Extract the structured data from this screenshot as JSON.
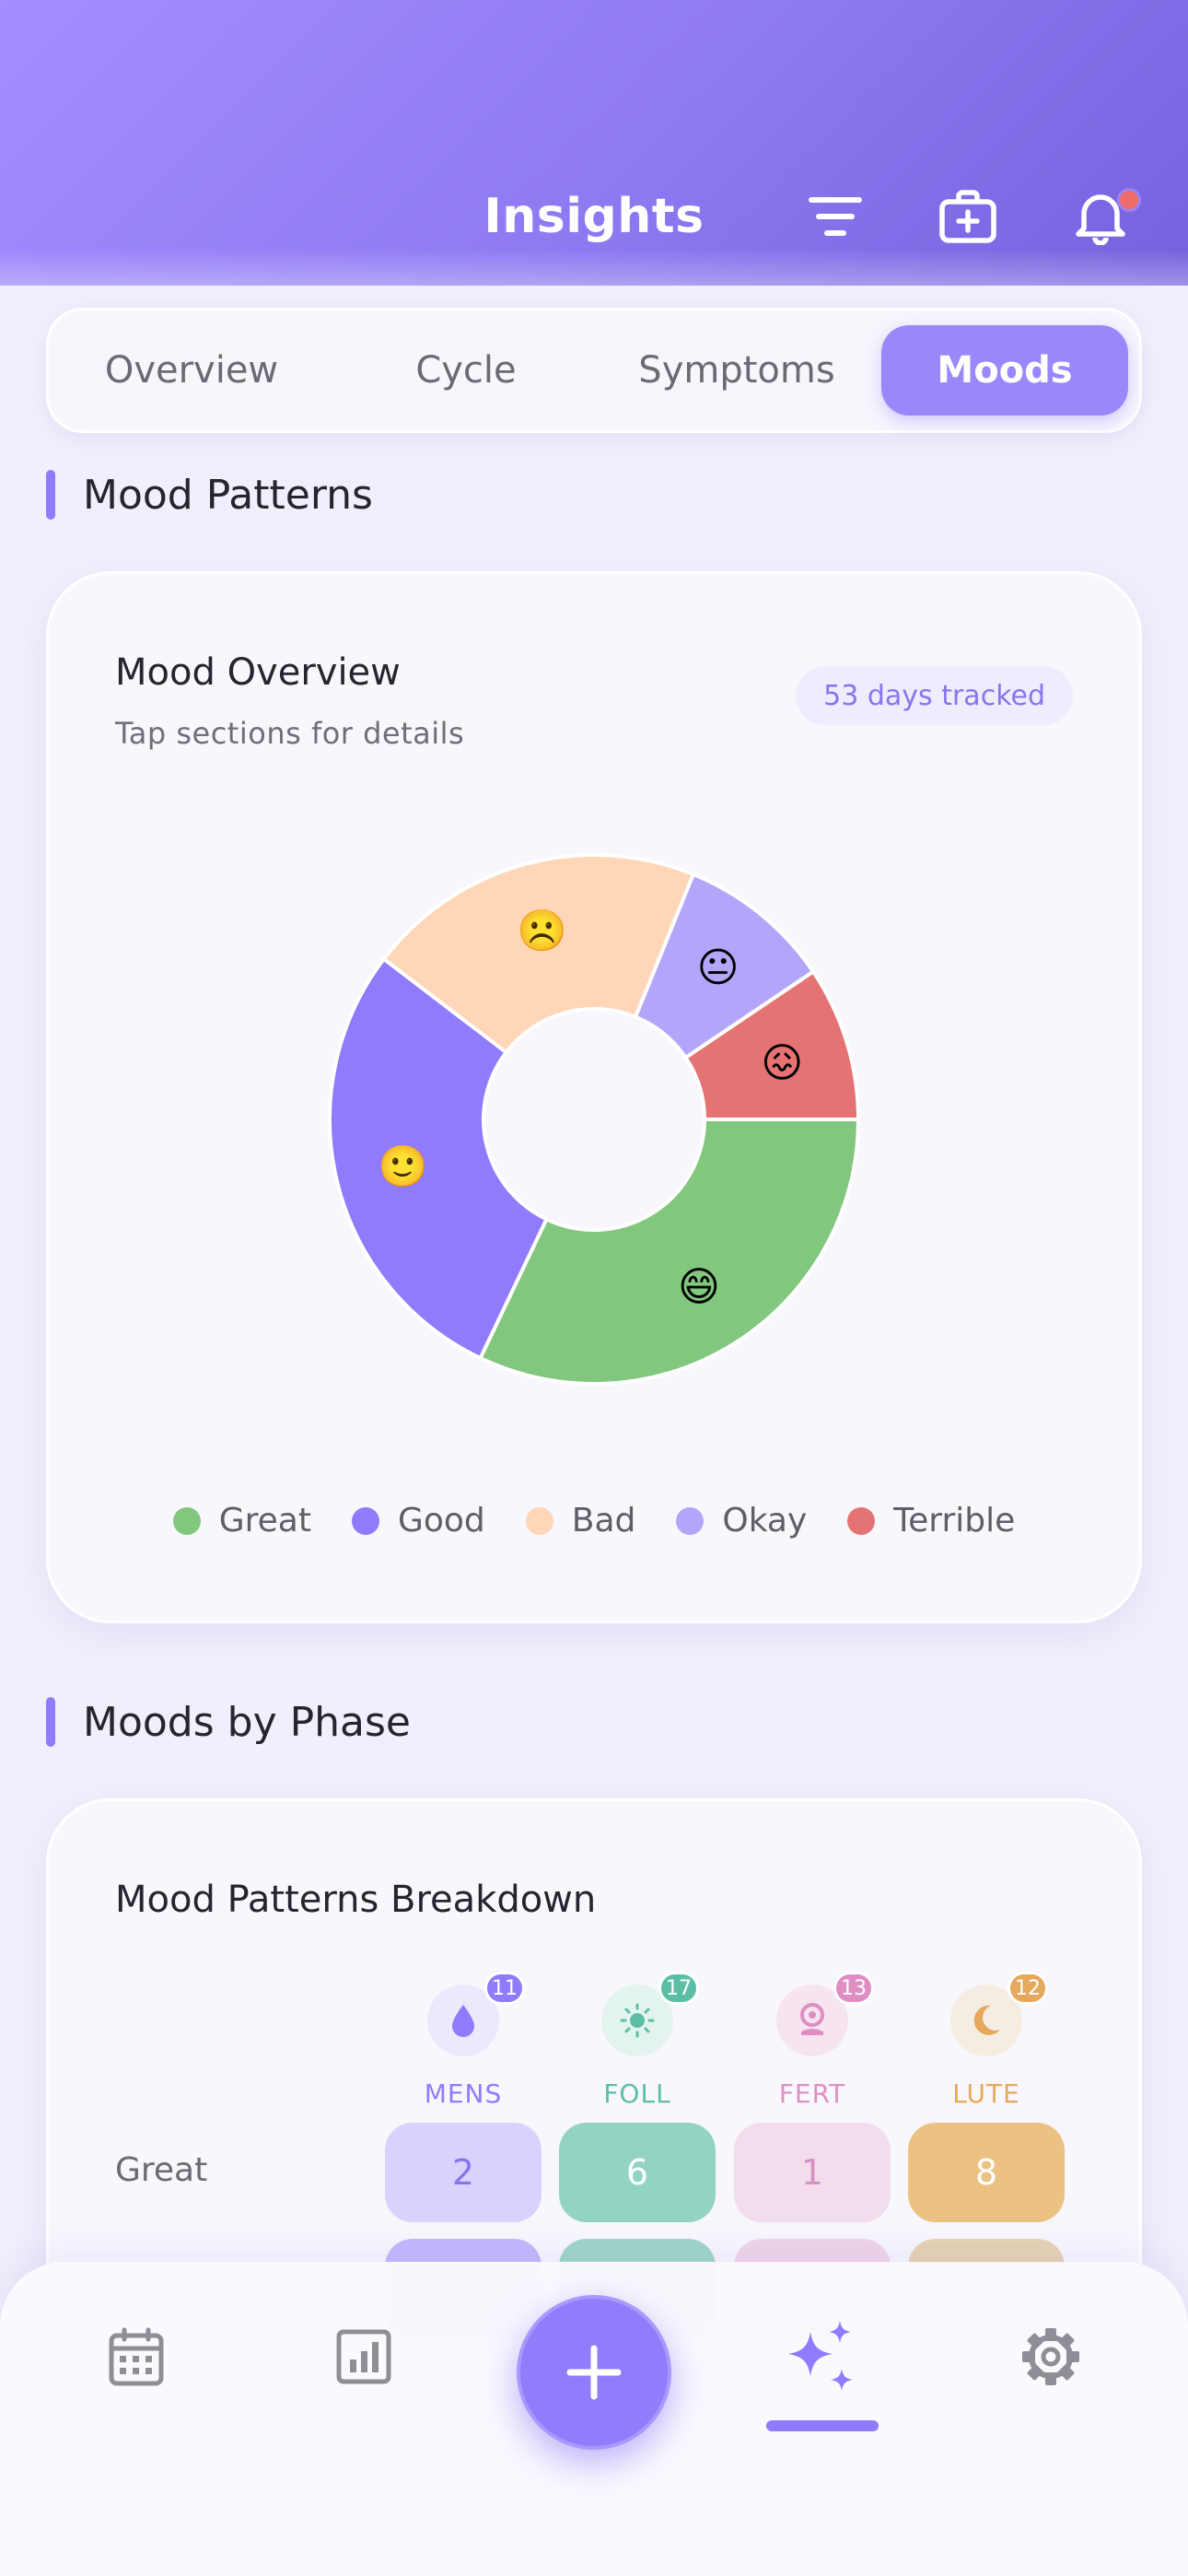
{
  "header": {
    "title": "Insights",
    "icons": [
      "filter-icon",
      "first-aid-kit-icon",
      "bell-icon"
    ],
    "notification_dot_color": "#ef6b6b"
  },
  "tabs": [
    {
      "label": "Overview",
      "active": false
    },
    {
      "label": "Cycle",
      "active": false
    },
    {
      "label": "Symptoms",
      "active": false
    },
    {
      "label": "Moods",
      "active": true
    }
  ],
  "sections": {
    "mood_patterns": "Mood Patterns",
    "moods_by_phase": "Moods by Phase"
  },
  "mood_overview": {
    "title": "Mood Overview",
    "subtitle": "Tap sections for details",
    "badge": "53 days tracked"
  },
  "chart_data": {
    "type": "pie",
    "donut": true,
    "slices": [
      {
        "label": "Great",
        "value": 17,
        "color": "#82c77e",
        "emoji": "😄"
      },
      {
        "label": "Good",
        "value": 15,
        "color": "#8f7bfb",
        "emoji": "🙂"
      },
      {
        "label": "Bad",
        "value": 11,
        "color": "#ffd6b8",
        "emoji": "☹️"
      },
      {
        "label": "Okay",
        "value": 5,
        "color": "#b3a6fa",
        "emoji": "😐"
      },
      {
        "label": "Terrible",
        "value": 5,
        "color": "#e57373",
        "emoji": "😖"
      }
    ],
    "legend_position": "bottom"
  },
  "legend": [
    {
      "label": "Great",
      "color": "#82c77e"
    },
    {
      "label": "Good",
      "color": "#8f7bfb"
    },
    {
      "label": "Bad",
      "color": "#ffd6b8"
    },
    {
      "label": "Okay",
      "color": "#b3a6fa"
    },
    {
      "label": "Terrible",
      "color": "#e57373"
    }
  ],
  "breakdown": {
    "title": "Mood Patterns Breakdown",
    "phases": [
      {
        "label": "MENS",
        "count": "11",
        "icon": "droplet-icon",
        "color": "#8f7bff",
        "bg": "#ece9fc"
      },
      {
        "label": "FOLL",
        "count": "17",
        "icon": "sun-icon",
        "color": "#5bbfa6",
        "bg": "#e3f3ee"
      },
      {
        "label": "FERT",
        "count": "13",
        "icon": "flower-icon",
        "color": "#df8ec4",
        "bg": "#f6e5f1"
      },
      {
        "label": "LUTE",
        "count": "12",
        "icon": "moon-icon",
        "color": "#e6a85c",
        "bg": "#f6ede2"
      }
    ],
    "rows": [
      {
        "label": "Great",
        "values": [
          "2",
          "6",
          "1",
          "8"
        ]
      }
    ],
    "cell_styles": [
      {
        "bg": "#d9d2fc",
        "color": "#8a74ee"
      },
      {
        "bg": "#92d3c3",
        "color": "#ffffff"
      },
      {
        "bg": "#f3ddec",
        "color": "#d493c2"
      },
      {
        "bg": "#ebc284",
        "color": "#ffffff"
      }
    ]
  },
  "bottom_nav": {
    "items": [
      "calendar-icon",
      "chart-icon",
      "add-icon",
      "sparkles-icon",
      "settings-icon"
    ],
    "active": "sparkles-icon"
  }
}
